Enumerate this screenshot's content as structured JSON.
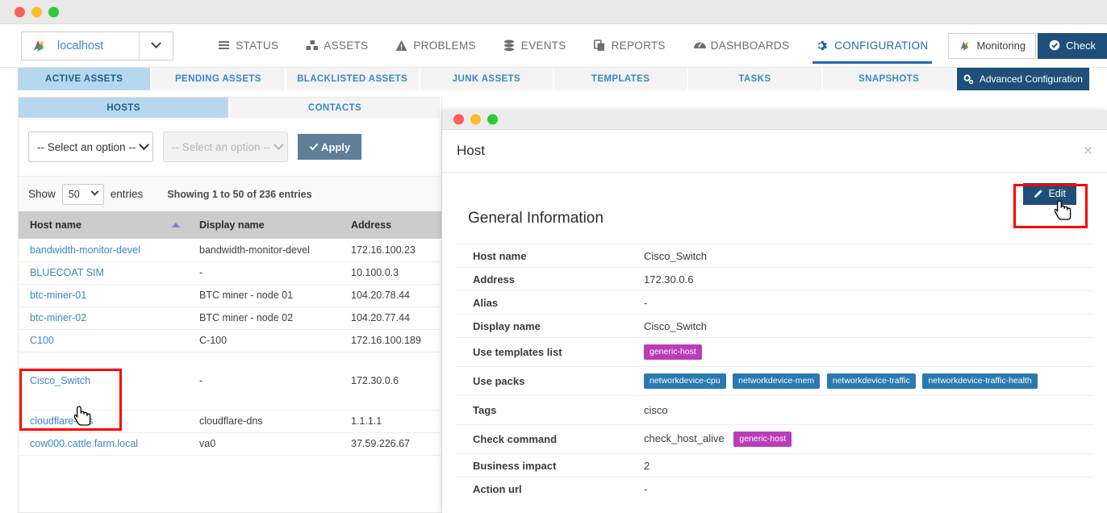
{
  "window": {
    "traffic_lights": [
      "close",
      "minimize",
      "maximize"
    ]
  },
  "navbar": {
    "host_selector": {
      "icon": "shinken-logo-icon",
      "value": "localhost",
      "caret": "chevron-down-icon"
    },
    "items": [
      {
        "label": "STATUS",
        "icon": "list-icon",
        "active": false
      },
      {
        "label": "ASSETS",
        "icon": "cubes-icon",
        "active": false
      },
      {
        "label": "PROBLEMS",
        "icon": "warning-icon",
        "active": false
      },
      {
        "label": "EVENTS",
        "icon": "database-icon",
        "active": false
      },
      {
        "label": "REPORTS",
        "icon": "copy-icon",
        "active": false
      },
      {
        "label": "DASHBOARDS",
        "icon": "dashboard-icon",
        "active": false
      },
      {
        "label": "CONFIGURATION",
        "icon": "gear-icon",
        "active": true
      }
    ],
    "monitoring_button": {
      "label": "Monitoring",
      "icon": "shinken-logo-icon"
    },
    "check_button": {
      "label": "Check",
      "icon": "check-circle-icon"
    }
  },
  "tabs": [
    {
      "label": "ACTIVE ASSETS",
      "active": true,
      "style": "light"
    },
    {
      "label": "PENDING ASSETS",
      "active": false,
      "style": "light"
    },
    {
      "label": "BLACKLISTED ASSETS",
      "active": false,
      "style": "light"
    },
    {
      "label": "JUNK ASSETS",
      "active": false,
      "style": "light"
    },
    {
      "label": "TEMPLATES",
      "active": false,
      "style": "light"
    },
    {
      "label": "TASKS",
      "active": false,
      "style": "light"
    },
    {
      "label": "SNAPSHOTS",
      "active": false,
      "style": "light"
    },
    {
      "label": "Advanced Configuration",
      "active": false,
      "style": "dark",
      "icon": "gears-icon"
    }
  ],
  "left_panel": {
    "subtabs": [
      {
        "label": "HOSTS",
        "active": true
      },
      {
        "label": "CONTACTS",
        "active": false
      }
    ],
    "filters": {
      "select_primary": {
        "value": "-- Select an option --",
        "disabled": false
      },
      "select_secondary": {
        "value": "-- Select an option --",
        "disabled": true
      },
      "apply_button": {
        "label": "Apply",
        "icon": "check-icon"
      }
    },
    "table_controls": {
      "show_label": "Show",
      "entries_value": "50",
      "entries_label": "entries",
      "showing_info": "Showing 1 to 50 of 236 entries"
    },
    "table": {
      "columns": [
        "Host name",
        "Display name",
        "Address"
      ],
      "sort_column": "Host name",
      "sort_direction": "asc",
      "rows": [
        {
          "host": "bandwidth-monitor-devel",
          "display": "bandwidth-monitor-devel",
          "address": "172.16.100.23",
          "selected": false
        },
        {
          "host": "BLUECOAT SIM",
          "display": "-",
          "address": "10.100.0.3",
          "selected": false
        },
        {
          "host": "btc-miner-01",
          "display": "BTC miner - node 01",
          "address": "104.20.78.44",
          "selected": false
        },
        {
          "host": "btc-miner-02",
          "display": "BTC miner - node 02",
          "address": "104.20.77.44",
          "selected": false
        },
        {
          "host": "C100",
          "display": "C-100",
          "address": "172.16.100.189",
          "selected": false
        },
        {
          "host": "Cisco_Switch",
          "display": "-",
          "address": "172.30.0.6",
          "selected": true
        },
        {
          "host": "cloudflare-dns",
          "display": "cloudflare-dns",
          "address": "1.1.1.1",
          "selected": false
        },
        {
          "host": "cow000.cattle.farm.local",
          "display": "va0",
          "address": "37.59.226.67",
          "selected": false
        }
      ]
    }
  },
  "detail": {
    "title": "Host",
    "close_icon": "close-icon",
    "edit_button": {
      "label": "Edit",
      "icon": "pencil-icon"
    },
    "section_title": "General Information",
    "fields": [
      {
        "label": "Host name",
        "value": "Cisco_Switch",
        "badges": []
      },
      {
        "label": "Address",
        "value": "172.30.0.6",
        "badges": []
      },
      {
        "label": "Alias",
        "value": "-",
        "badges": []
      },
      {
        "label": "Display name",
        "value": "Cisco_Switch",
        "badges": []
      },
      {
        "label": "Use templates list",
        "value": "",
        "badges": [
          {
            "text": "generic-host",
            "color": "purple"
          }
        ]
      },
      {
        "label": "Use packs",
        "value": "",
        "badges": [
          {
            "text": "networkdevice-cpu",
            "color": "blue"
          },
          {
            "text": "networkdevice-mem",
            "color": "blue"
          },
          {
            "text": "networkdevice-traffic",
            "color": "blue"
          },
          {
            "text": "networkdevice-traffic-health",
            "color": "blue"
          }
        ]
      },
      {
        "label": "Tags",
        "value": "cisco",
        "badges": []
      },
      {
        "label": "Check command",
        "value": "check_host_alive",
        "badges": [
          {
            "text": "generic-host",
            "color": "purple"
          }
        ]
      },
      {
        "label": "Business impact",
        "value": "2",
        "badges": []
      },
      {
        "label": "Action url",
        "value": "-",
        "badges": []
      }
    ]
  },
  "colors": {
    "accent_blue": "#3a87c8",
    "dark_blue": "#1d4f78",
    "active_tab_bg": "#b6d8ef",
    "highlight_red": "#ff0000",
    "badge_purple": "#b93db9",
    "badge_blue": "#2a7ab0",
    "apply_button": "#5f7f99"
  },
  "annotations": {
    "row_highlight_target": "Cisco_Switch",
    "edit_highlight_target": "Edit"
  }
}
